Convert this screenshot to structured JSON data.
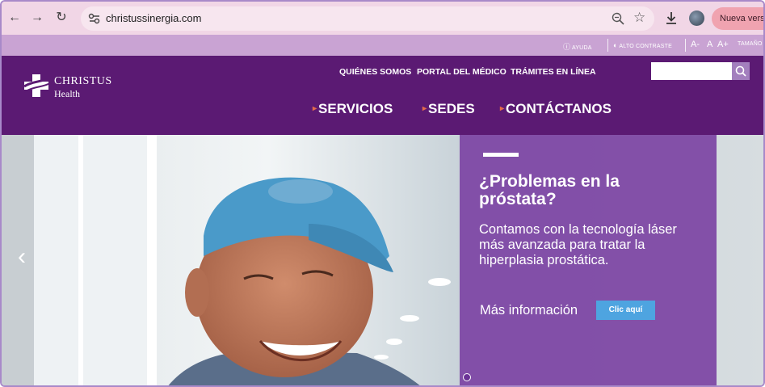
{
  "browser": {
    "url": "christussinergia.com",
    "new_version_label": "Nueva versión"
  },
  "utility_bar": {
    "help": "AYUDA",
    "high_contrast": "ALTO CONTRASTE",
    "font_decrease": "A-",
    "font_normal": "A",
    "font_increase": "A+",
    "size_label": "TAMAÑO"
  },
  "header": {
    "logo_line1": "CHRISTUS",
    "logo_line2": "Health",
    "top_links": [
      "QUIÉNES SOMOS",
      "PORTAL DEL MÉDICO",
      "TRÁMITES EN LÍNEA"
    ],
    "main_nav": [
      "SERVICIOS",
      "SEDES",
      "CONTÁCTANOS"
    ],
    "search_placeholder": ""
  },
  "hero": {
    "title": "¿Problemas en la próstata?",
    "text": "Contamos con la tecnología láser más avanzada para tratar la hiperplasia prostática.",
    "more_label": "Más información",
    "button_label": "Clic aquí",
    "prev_arrow": "‹"
  },
  "colors": {
    "header_bg": "#5b1a73",
    "utility_bg": "#c9a3d3",
    "panel_bg": "#783ca0",
    "button_bg": "#4ea4e0",
    "nav_arrow": "#e46b4a"
  }
}
